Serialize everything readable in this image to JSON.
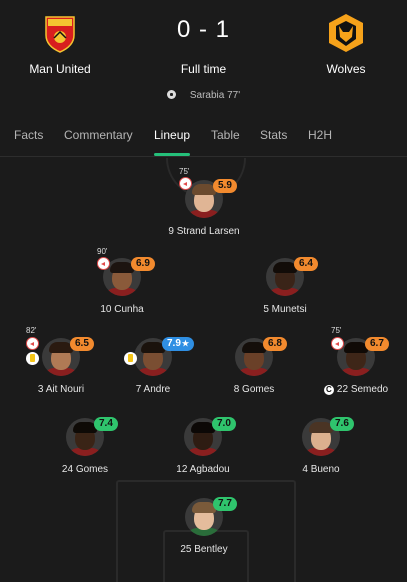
{
  "match": {
    "home_team": "Man United",
    "away_team": "Wolves",
    "score": "0 - 1",
    "status": "Full time",
    "scorer": "Sarabia 77'"
  },
  "colors": {
    "accent": "#25c07a",
    "orange": "#f28a2e",
    "green": "#2fc46d",
    "blue": "#2f8fe3"
  },
  "tabs": [
    "Facts",
    "Commentary",
    "Lineup",
    "Table",
    "Stats",
    "H2H"
  ],
  "active_tab": "Lineup",
  "lineup": {
    "players": [
      {
        "id": "larsen",
        "number": "9",
        "name": "Strand Larsen",
        "rating": "5.9",
        "rating_color": "orange",
        "sub_minute": "75'"
      },
      {
        "id": "cunha",
        "number": "10",
        "name": "Cunha",
        "rating": "6.9",
        "rating_color": "orange",
        "sub_minute": "90'"
      },
      {
        "id": "munetsi",
        "number": "5",
        "name": "Munetsi",
        "rating": "6.4",
        "rating_color": "orange"
      },
      {
        "id": "aitnouri",
        "number": "3",
        "name": "Ait Nouri",
        "rating": "6.5",
        "rating_color": "orange",
        "sub_minute": "82'",
        "yellow_card": true
      },
      {
        "id": "andre",
        "number": "7",
        "name": "Andre",
        "rating": "7.9",
        "rating_color": "blue",
        "star": "★",
        "yellow_card": true
      },
      {
        "id": "gomes8",
        "number": "8",
        "name": "Gomes",
        "rating": "6.8",
        "rating_color": "orange"
      },
      {
        "id": "semedo",
        "number": "22",
        "name": "Semedo",
        "rating": "6.7",
        "rating_color": "orange",
        "sub_minute": "75'",
        "captain": "C"
      },
      {
        "id": "gomes24",
        "number": "24",
        "name": "Gomes",
        "rating": "7.4",
        "rating_color": "green"
      },
      {
        "id": "agbadou",
        "number": "12",
        "name": "Agbadou",
        "rating": "7.0",
        "rating_color": "green"
      },
      {
        "id": "bueno",
        "number": "4",
        "name": "Bueno",
        "rating": "7.6",
        "rating_color": "green"
      },
      {
        "id": "bentley",
        "number": "25",
        "name": "Bentley",
        "rating": "7.7",
        "rating_color": "green"
      }
    ]
  }
}
